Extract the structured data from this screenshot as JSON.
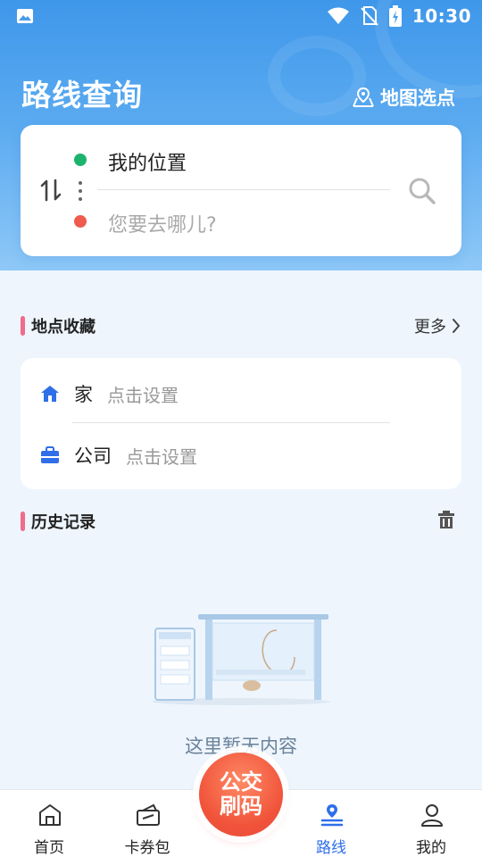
{
  "status_bar": {
    "time": "10:30",
    "icons": [
      "image-icon",
      "wifi-icon",
      "no-sim-icon",
      "battery-charging-icon"
    ]
  },
  "header": {
    "title": "路线查询",
    "map_pick_label": "地图选点",
    "map_pick_icon": "map-pin-icon"
  },
  "route": {
    "from": "我的位置",
    "to_placeholder": "您要去哪儿?",
    "swap_icon": "swap-icon",
    "search_icon": "search-icon"
  },
  "favorites": {
    "title": "地点收藏",
    "more_label": "更多",
    "items": [
      {
        "name": "家",
        "hint": "点击设置",
        "icon": "home-icon"
      },
      {
        "name": "公司",
        "hint": "点击设置",
        "icon": "briefcase-icon"
      }
    ]
  },
  "history": {
    "title": "历史记录",
    "clear_icon": "trash-icon",
    "empty_text": "这里暂无内容"
  },
  "fab": {
    "label_line1": "公交",
    "label_line2": "刷码"
  },
  "tabs": [
    {
      "label": "首页",
      "icon": "home-outline-icon",
      "active": false
    },
    {
      "label": "卡券包",
      "icon": "coupon-icon",
      "active": false
    },
    {
      "label": "路线",
      "icon": "route-icon",
      "active": true
    },
    {
      "label": "我的",
      "icon": "user-icon",
      "active": false
    }
  ],
  "colors": {
    "header_gradient_top": "#3f97ea",
    "accent_blue": "#2f6fe8",
    "start_dot": "#1db36d",
    "end_dot": "#ef5b4e",
    "section_marker": "#ef6c8c",
    "fab": "#f0533a"
  }
}
